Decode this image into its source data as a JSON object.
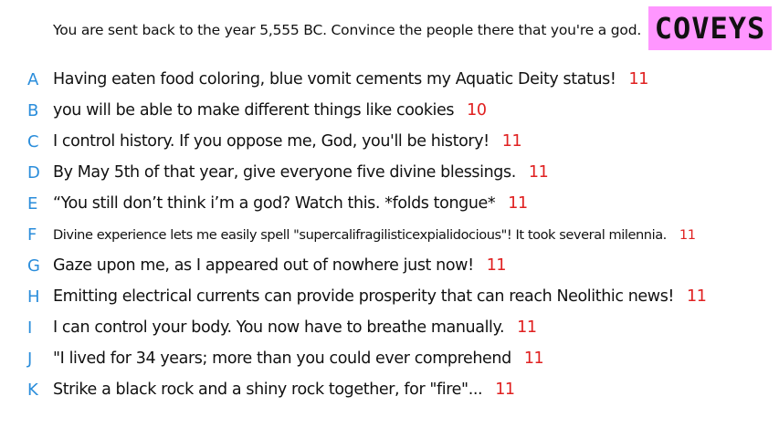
{
  "prompt": "You are sent back to the year 5,555 BC. Convince the people there that you're a god.",
  "brand": "COVEYS",
  "colors": {
    "badge_background": "#ff96ff",
    "letter": "#2a8ddb",
    "score": "#e02020"
  },
  "answers": [
    {
      "letter": "A",
      "text": "Having eaten food coloring, blue vomit cements my Aquatic Deity status!",
      "score": "11"
    },
    {
      "letter": "B",
      "text": "you will be able to make different things like cookies",
      "score": "10"
    },
    {
      "letter": "C",
      "text": "I control history. If you oppose me, God, you'll be history!",
      "score": "11"
    },
    {
      "letter": "D",
      "text": "By May 5th of that year, give everyone five divine blessings.",
      "score": "11"
    },
    {
      "letter": "E",
      "text": "“You still don’t think i’m a god? Watch this.  *folds tongue*",
      "score": "11"
    },
    {
      "letter": "F",
      "text": "Divine experience lets me easily spell \"supercalifragilisticexpialidocious\"! It took several milennia.",
      "score": "11"
    },
    {
      "letter": "G",
      "text": "Gaze upon me, as I appeared out of nowhere just now!",
      "score": "11"
    },
    {
      "letter": "H",
      "text": "Emitting electrical currents can provide prosperity that can reach Neolithic news!",
      "score": "11"
    },
    {
      "letter": "I",
      "text": "I can control your body. You now have to breathe manually.",
      "score": "11"
    },
    {
      "letter": "J",
      "text": "\"I lived for 34 years; more than you could ever comprehend",
      "score": "11"
    },
    {
      "letter": "K",
      "text": "Strike a black rock and a shiny rock together, for \"fire\"...",
      "score": "11"
    }
  ]
}
